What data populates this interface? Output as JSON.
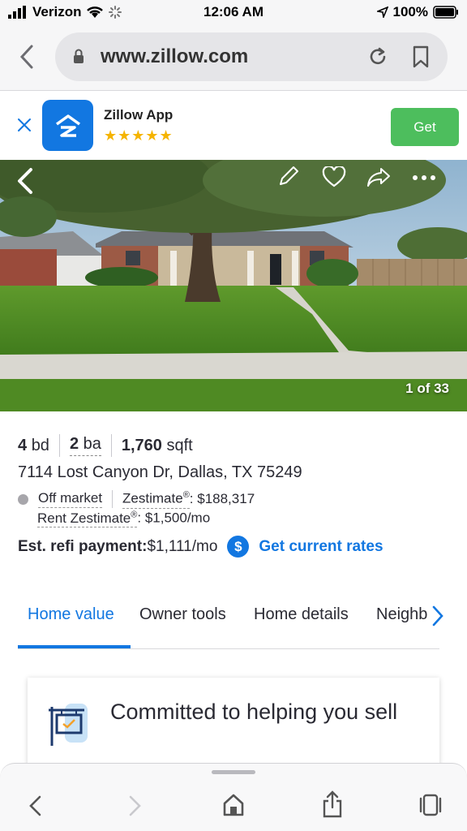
{
  "status_bar": {
    "carrier": "Verizon",
    "time": "12:06 AM",
    "battery": "100%"
  },
  "browser": {
    "url": "www.zillow.com"
  },
  "app_banner": {
    "app_name": "Zillow App",
    "stars": "★★★★★",
    "get_label": "Get"
  },
  "photo": {
    "counter": "1 of 33"
  },
  "facts": {
    "beds_num": "4",
    "beds_unit": "bd",
    "baths_num": "2",
    "baths_unit": "ba",
    "sqft_num": "1,760",
    "sqft_unit": "sqft"
  },
  "address": "7114 Lost Canyon Dr, Dallas, TX 75249",
  "status": {
    "market_status": "Off market",
    "zestimate_label": "Zestimate",
    "zestimate_value": ": $188,317",
    "rent_label": "Rent Zestimate",
    "rent_value": ": $1,500/mo",
    "registered": "®"
  },
  "refi": {
    "label": "Est. refi payment:",
    "value": " $1,111/mo",
    "badge": "$",
    "link": "Get current rates"
  },
  "tabs": [
    {
      "label": "Home value"
    },
    {
      "label": "Owner tools"
    },
    {
      "label": "Home details"
    },
    {
      "label": "Neighb"
    }
  ],
  "card": {
    "title": "Committed to helping you sell"
  },
  "colors": {
    "accent": "#1277e1",
    "get_green": "#4dbe5d",
    "star": "#f5b400"
  }
}
